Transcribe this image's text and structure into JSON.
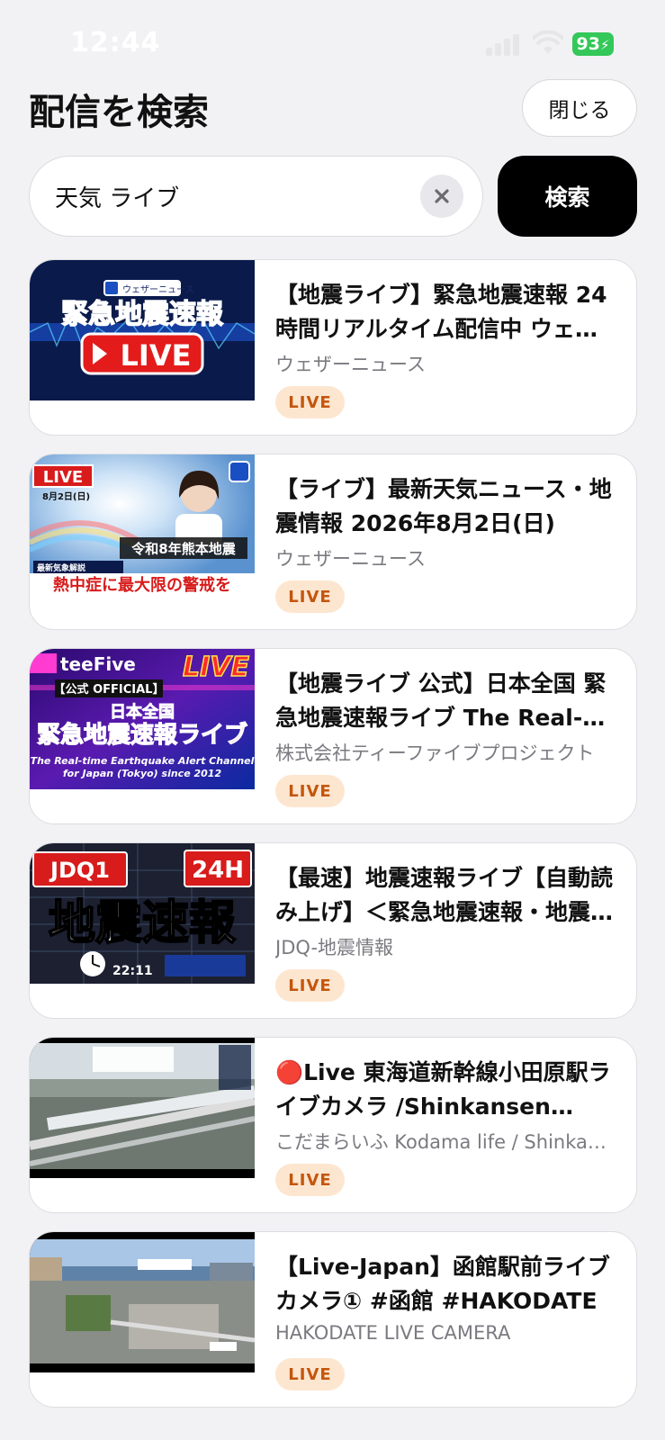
{
  "status_bar": {
    "time": "12:44",
    "battery": "93"
  },
  "header": {
    "title": "配信を検索",
    "close_label": "閉じる"
  },
  "search": {
    "value": "天気 ライブ",
    "button_label": "検索"
  },
  "colors": {
    "live_badge_bg": "#fde6d0",
    "live_badge_text": "#c4560d",
    "search_button": "#000000"
  },
  "results": [
    {
      "title": "【地震ライブ】緊急地震速報 24時間リアルタイム配信中 ウェザーニュース",
      "channel": "ウェザーニュース",
      "badge": "LIVE",
      "thumb": {
        "text_main": "緊急地震速報",
        "text_sub": "LIVE",
        "brand": "ウェザーニュース"
      }
    },
    {
      "title": "【ライブ】最新天気ニュース・地震情報 2026年8月2日(日)",
      "channel": "ウェザーニュース",
      "badge": "LIVE",
      "thumb": {
        "live": "LIVE",
        "date": "8月2日(日)",
        "caption1": "令和8年熊本地震",
        "caption2": "最新気象解説",
        "caption3": "熱中症に最大限の警戒を"
      }
    },
    {
      "title": "【地震ライブ 公式】日本全国 緊急地震速報ライブ The Real-time Earthquake Alert Channel",
      "channel": "株式会社ティーファイブプロジェクト",
      "badge": "LIVE",
      "thumb": {
        "brand": "teeFive",
        "official": "【公式 OFFICIAL】",
        "live": "LIVE",
        "line1": "日本全国",
        "line2": "緊急地震速報ライブ",
        "line3": "The Real-time Earthquake Alert Channel",
        "line4": "for Japan (Tokyo) since 2012"
      }
    },
    {
      "title": "【最速】地震速報ライブ【自動読み上げ】＜緊急地震速報・地震情報＞",
      "channel": "JDQ-地震情報",
      "badge": "LIVE",
      "thumb": {
        "brand": "JDQ1",
        "hours": "24H",
        "main": "地震速報",
        "time": "22:11"
      }
    },
    {
      "title": "🔴Live 東海道新幹線小田原駅ライブカメラ /Shinkansen Odawara Station",
      "channel": "こだまらいふ Kodama life / Shinkansen",
      "badge": "LIVE",
      "thumb": {}
    },
    {
      "title": "【Live-Japan】函館駅前ライブカメラ① #函館 #HAKODATE",
      "channel": "HAKODATE LIVE CAMERA",
      "badge": "LIVE",
      "thumb": {}
    }
  ]
}
